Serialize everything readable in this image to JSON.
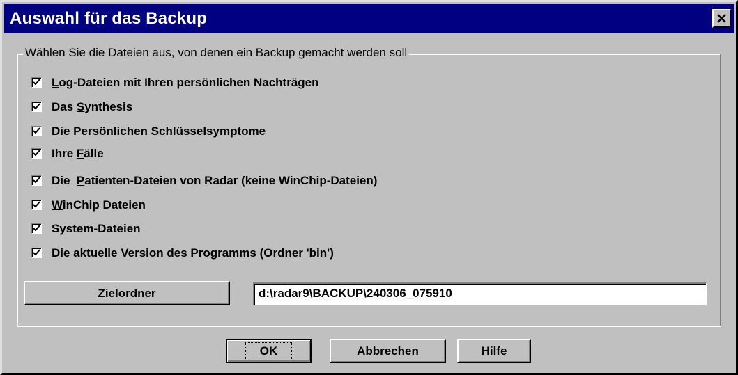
{
  "window": {
    "title": "Auswahl für das Backup",
    "close_glyph": "close-icon"
  },
  "group": {
    "legend": "Wählen Sie die Dateien aus, von denen ein Backup gemacht werden soll"
  },
  "checkboxes": [
    {
      "pre": "",
      "mn": "L",
      "post": "og-Dateien mit Ihren persönlichen Nachträgen",
      "checked": true
    },
    {
      "pre": "Das ",
      "mn": "S",
      "post": "ynthesis",
      "checked": true
    },
    {
      "pre": "Die Persönlichen ",
      "mn": "S",
      "post": "chlüsselsymptome",
      "checked": true
    },
    {
      "pre": "Ihre ",
      "mn": "F",
      "post": "älle",
      "checked": true
    },
    {
      "pre": "Die  ",
      "mn": "P",
      "post": "atienten-Dateien von Radar (keine WinChip-Dateien)",
      "checked": true
    },
    {
      "pre": "",
      "mn": "W",
      "post": "inChip Dateien",
      "checked": true
    },
    {
      "pre": "System-Dateien",
      "mn": "",
      "post": "",
      "checked": true
    },
    {
      "pre": "Die aktuelle Version des Programms (Ordner 'bin')",
      "mn": "",
      "post": "",
      "checked": true
    }
  ],
  "target": {
    "button_mn": "Z",
    "button_rest": "ielordner",
    "path_value": "d:\\radar9\\BACKUP\\240306_075910"
  },
  "buttons": {
    "ok": "OK",
    "cancel": "Abbrechen",
    "help_mn": "H",
    "help_rest": "ilfe"
  },
  "colors": {
    "titlebar": "#000080",
    "face": "#c0c0c0"
  }
}
